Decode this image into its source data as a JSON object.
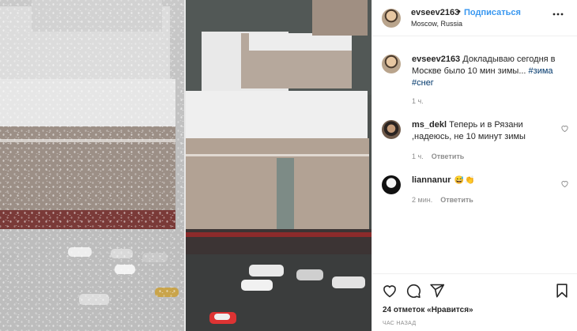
{
  "post": {
    "author": {
      "username": "evseev2163",
      "follow_label": "Подписаться",
      "separator": "•",
      "location": "Moscow, Russia",
      "avatar_icon": "user-avatar"
    },
    "caption": {
      "username": "evseev2163",
      "text": "Докладываю сегодня в Москве было 10 мин зимы... ",
      "hashtags": [
        "#зима",
        "#снег"
      ],
      "time": "1 ч."
    },
    "comments": [
      {
        "username": "ms_dekl",
        "text": "Теперь и в Рязани ,надеюсь, не 10 минут зимы",
        "time": "1 ч.",
        "reply_label": "Ответить"
      },
      {
        "username": "liannanur",
        "emojis": [
          "😅",
          "👏"
        ],
        "time": "2 мин.",
        "reply_label": "Ответить"
      }
    ],
    "likes_text": "24 отметок «Нравится»",
    "posted_ago": "ЧАС НАЗАД",
    "more_icon": "more-options-icon",
    "icons": [
      "heart-icon",
      "comment-icon",
      "share-icon",
      "bookmark-icon"
    ]
  },
  "colors": {
    "link_blue": "#3897f0",
    "hashtag": "#00376b",
    "muted": "#8e8e8e",
    "text": "#262626"
  }
}
